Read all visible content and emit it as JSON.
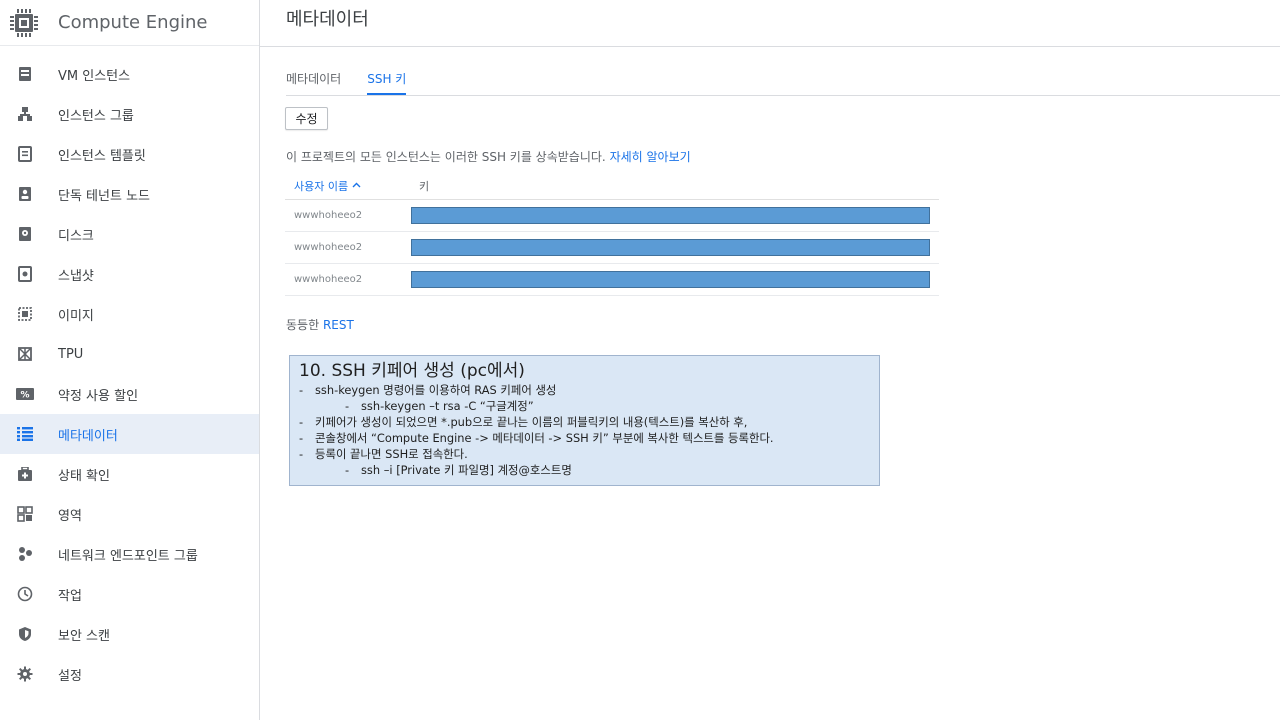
{
  "product": {
    "title": "Compute Engine",
    "logo_icon": "chip-icon"
  },
  "sidebar": {
    "items": [
      {
        "label": "VM 인스턴스",
        "icon": "vm-instance-icon"
      },
      {
        "label": "인스턴스 그룹",
        "icon": "instance-group-icon"
      },
      {
        "label": "인스턴스 템플릿",
        "icon": "instance-template-icon"
      },
      {
        "label": "단독 테넌트 노드",
        "icon": "sole-tenant-icon"
      },
      {
        "label": "디스크",
        "icon": "disk-icon"
      },
      {
        "label": "스냅샷",
        "icon": "snapshot-icon"
      },
      {
        "label": "이미지",
        "icon": "image-icon"
      },
      {
        "label": "TPU",
        "icon": "tpu-icon"
      },
      {
        "label": "약정 사용 할인",
        "icon": "discount-icon"
      },
      {
        "label": "메타데이터",
        "icon": "metadata-icon",
        "active": true
      },
      {
        "label": "상태 확인",
        "icon": "health-check-icon"
      },
      {
        "label": "영역",
        "icon": "zones-icon"
      },
      {
        "label": "네트워크 엔드포인트 그룹",
        "icon": "network-endpoint-icon"
      },
      {
        "label": "작업",
        "icon": "clock-icon"
      },
      {
        "label": "보안 스캔",
        "icon": "shield-icon"
      },
      {
        "label": "설정",
        "icon": "gear-icon"
      }
    ]
  },
  "page": {
    "title": "메타데이터"
  },
  "tabs": [
    {
      "label": "메타데이터",
      "active": false
    },
    {
      "label": "SSH 키",
      "active": true
    }
  ],
  "edit_button": "수정",
  "info": {
    "text": "이 프로젝트의 모든 인스턴스는 이러한 SSH 키를 상속받습니다.",
    "link": "자세히 알아보기"
  },
  "table": {
    "col_user": "사용자 이름",
    "col_key": "키",
    "rows": [
      {
        "user": "wwwhoheeo2"
      },
      {
        "user": "wwwhoheeo2"
      },
      {
        "user": "wwwhoheeo2"
      }
    ]
  },
  "rest": {
    "prefix": "동등한",
    "link": "REST"
  },
  "note": {
    "title": "10. SSH 키페어 생성 (pc에서)",
    "lines": [
      "ssh-keygen 명령어를 이용하여 RAS 키페어 생성",
      "ssh-keygen –t rsa -C “구글계정”",
      "키페어가 생성이 되었으면 *.pub으로 끝나는 이름의 퍼블릭키의 내용(텍스트)를 복산하 후,",
      "콘솔창에서 “Compute Engine -> 메타데이터 -> SSH 키” 부분에 복사한 텍스트를 등록한다.",
      "등록이 끝나면 SSH로 접속한다.",
      "ssh –i [Private 키 파일명] 계정@호스트명"
    ]
  },
  "colors": {
    "accent": "#1a73e8",
    "active_bg": "#e8eef7",
    "key_bar": "#5b9bd5",
    "note_bg": "#dae7f5"
  }
}
